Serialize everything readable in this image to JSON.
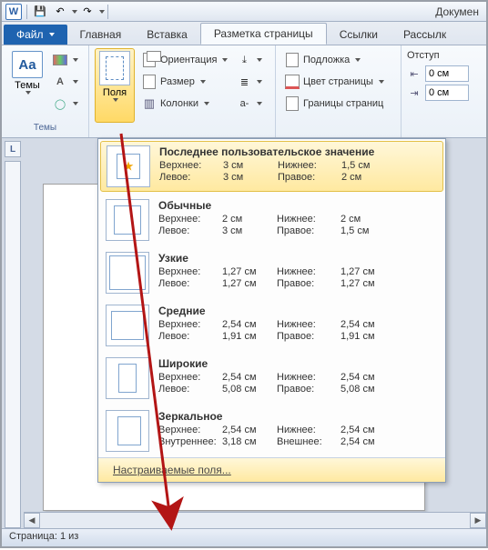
{
  "title": "Докумен",
  "qat": {
    "save": "💾",
    "undo": "↶",
    "redo": "↷"
  },
  "tabs": {
    "file": "Файл",
    "home": "Главная",
    "insert": "Вставка",
    "layout": "Разметка страницы",
    "references": "Ссылки",
    "mailings": "Рассылк"
  },
  "ribbon": {
    "themes_group": "Темы",
    "themes_btn": "Темы",
    "margins_btn": "Поля",
    "orientation": "Ориентация",
    "size": "Размер",
    "columns": "Колонки",
    "watermark": "Подложка",
    "page_color": "Цвет страницы",
    "page_borders": "Границы страниц",
    "indent_lbl": "Отступ",
    "indent_val": "0 см"
  },
  "gallery": {
    "labels": {
      "top": "Верхнее:",
      "bottom": "Нижнее:",
      "left": "Левое:",
      "right": "Правое:",
      "inside": "Внутреннее:",
      "outside": "Внешнее:"
    },
    "items": [
      {
        "name": "Последнее пользовательское значение",
        "top": "3 см",
        "bottom": "1,5 см",
        "left": "3 см",
        "right": "2 см",
        "star": true
      },
      {
        "name": "Обычные",
        "top": "2 см",
        "bottom": "2 см",
        "left": "3 см",
        "right": "1,5 см"
      },
      {
        "name": "Узкие",
        "top": "1,27 см",
        "bottom": "1,27 см",
        "left": "1,27 см",
        "right": "1,27 см"
      },
      {
        "name": "Средние",
        "top": "2,54 см",
        "bottom": "2,54 см",
        "left": "1,91 см",
        "right": "1,91 см"
      },
      {
        "name": "Широкие",
        "top": "2,54 см",
        "bottom": "2,54 см",
        "left": "5,08 см",
        "right": "5,08 см"
      },
      {
        "name": "Зеркальное",
        "top": "2,54 см",
        "bottom": "2,54 см",
        "left": "3,18 см",
        "right": "2,54 см",
        "mirror": true
      }
    ],
    "custom": "Настраиваемые поля..."
  },
  "status": "Страница: 1 из",
  "corner": "L"
}
